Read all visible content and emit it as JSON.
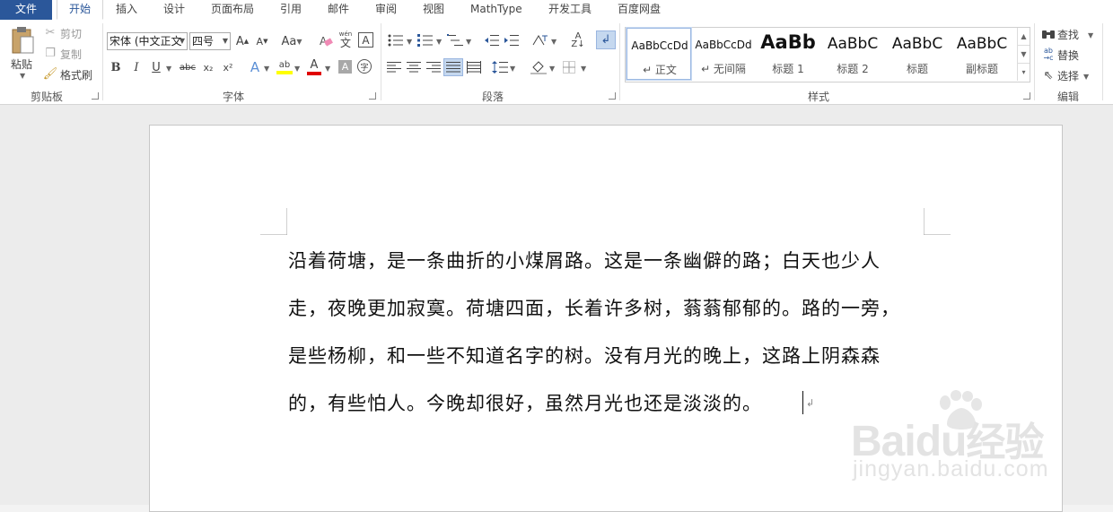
{
  "tabs": [
    "文件",
    "开始",
    "插入",
    "设计",
    "页面布局",
    "引用",
    "邮件",
    "审阅",
    "视图",
    "MathType",
    "开发工具",
    "百度网盘"
  ],
  "clipboard": {
    "paste": "粘贴",
    "cut": "剪切",
    "copy": "复制",
    "format_painter": "格式刷",
    "group": "剪贴板"
  },
  "font": {
    "name": "宋体 (中文正文",
    "size": "四号",
    "case_label": "Aa",
    "group": "字体",
    "bold": "B",
    "italic": "I",
    "underline": "U",
    "strike": "abc",
    "sub": "x₂",
    "sup": "x²",
    "pinyin_top": "wén",
    "pinyin_char": "文",
    "border_char": "A",
    "enclose_char": "字",
    "highlight_char": "ab",
    "color_char": "A",
    "shade_char": "A"
  },
  "paragraph": {
    "group": "段落"
  },
  "styles": {
    "group": "样式",
    "items": [
      {
        "preview": "AaBbCcDd",
        "name": "↵ 正文"
      },
      {
        "preview": "AaBbCcDd",
        "name": "↵ 无间隔"
      },
      {
        "preview": "AaBb",
        "name": "标题 1"
      },
      {
        "preview": "AaBbC",
        "name": "标题 2"
      },
      {
        "preview": "AaBbC",
        "name": "标题"
      },
      {
        "preview": "AaBbC",
        "name": "副标题"
      }
    ]
  },
  "editing": {
    "find": "查找",
    "replace": "替换",
    "select": "选择",
    "group": "编辑"
  },
  "document": {
    "lines": [
      "沿着荷塘，是一条曲折的小煤屑路。这是一条幽僻的路；白天也少人",
      "走，夜晚更加寂寞。荷塘四面，长着许多树，蓊蓊郁郁的。路的一旁，",
      "是些杨柳，和一些不知道名字的树。没有月光的晚上，这路上阴森森",
      "的，有些怕人。今晚却很好，虽然月光也还是淡淡的。"
    ]
  },
  "watermark": {
    "brand": "Baidu",
    "brand_cn": "经验",
    "url": "jingyan.baidu.com"
  },
  "colors": {
    "file_tab": "#2b579a",
    "font_red": "#e00000",
    "highlight": "#ffff00"
  }
}
